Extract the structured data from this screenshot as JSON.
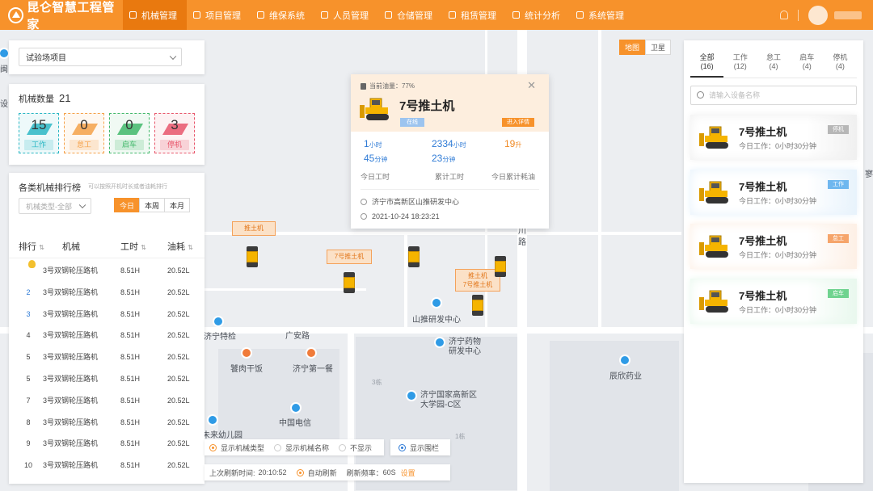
{
  "app": {
    "title": "昆仑智慧工程管家"
  },
  "nav": [
    {
      "label": "机械管理",
      "active": true,
      "icon": "machine-icon"
    },
    {
      "label": "项目管理",
      "active": false,
      "icon": "project-icon"
    },
    {
      "label": "维保系统",
      "active": false,
      "icon": "maintenance-icon"
    },
    {
      "label": "人员管理",
      "active": false,
      "icon": "people-icon"
    },
    {
      "label": "仓储管理",
      "active": false,
      "icon": "warehouse-icon"
    },
    {
      "label": "租赁管理",
      "active": false,
      "icon": "lease-icon"
    },
    {
      "label": "统计分析",
      "active": false,
      "icon": "stats-icon"
    },
    {
      "label": "系统管理",
      "active": false,
      "icon": "settings-icon"
    }
  ],
  "map_switch": {
    "map": "地图",
    "satellite": "卫星",
    "active": "map"
  },
  "project": {
    "selected": "试验场项目"
  },
  "machine_count": {
    "label": "机械数量",
    "total": "21",
    "stats": [
      {
        "num": "15",
        "label": "工作",
        "color": "#2bb7c4"
      },
      {
        "num": "0",
        "label": "怠工",
        "color": "#f5a24a"
      },
      {
        "num": "0",
        "label": "启车",
        "color": "#41b86a"
      },
      {
        "num": "3",
        "label": "停机",
        "color": "#e8566b"
      }
    ]
  },
  "ranking": {
    "title": "各类机械排行榜",
    "subtitle": "可以按照开机时长或者油耗排行",
    "type_select_placeholder": "机械类型-全部",
    "periods": [
      "今日",
      "本周",
      "本月"
    ],
    "active_period": "今日",
    "headers": {
      "rank": "排行",
      "name": "机械",
      "hours": "工时",
      "oil": "油耗"
    },
    "sort_icon": "sort-arrows-icon",
    "rows": [
      {
        "rank": "1",
        "name": "3号双钢轮压路机",
        "hours": "8.51H",
        "oil": "20.52L"
      },
      {
        "rank": "2",
        "name": "3号双钢轮压路机",
        "hours": "8.51H",
        "oil": "20.52L"
      },
      {
        "rank": "3",
        "name": "3号双钢轮压路机",
        "hours": "8.51H",
        "oil": "20.52L"
      },
      {
        "rank": "4",
        "name": "3号双钢轮压路机",
        "hours": "8.51H",
        "oil": "20.52L"
      },
      {
        "rank": "5",
        "name": "3号双钢轮压路机",
        "hours": "8.51H",
        "oil": "20.52L"
      },
      {
        "rank": "5",
        "name": "3号双钢轮压路机",
        "hours": "8.51H",
        "oil": "20.52L"
      },
      {
        "rank": "7",
        "name": "3号双钢轮压路机",
        "hours": "8.51H",
        "oil": "20.52L"
      },
      {
        "rank": "8",
        "name": "3号双钢轮压路机",
        "hours": "8.51H",
        "oil": "20.52L"
      },
      {
        "rank": "9",
        "name": "3号双钢轮压路机",
        "hours": "8.51H",
        "oil": "20.52L"
      },
      {
        "rank": "10",
        "name": "3号双钢轮压路机",
        "hours": "8.51H",
        "oil": "20.52L"
      }
    ]
  },
  "popup": {
    "oil_label": "当前油量：77%",
    "name": "7号推土机",
    "status": "在线",
    "detail_button": "进入详情",
    "stats": [
      {
        "line1": "1",
        "unit1": "小时",
        "line2": "45",
        "unit2": "分钟",
        "caption": "今日工时"
      },
      {
        "line1": "2334",
        "unit1": "小时",
        "line2": "23",
        "unit2": "分钟",
        "caption": "累计工时"
      },
      {
        "line1": "19",
        "unit1": "升",
        "line2": "",
        "unit2": "",
        "caption": "今日累计耗油"
      }
    ],
    "location": "济宁市高新区山推研发中心",
    "time": "2021-10-24  18:23:21"
  },
  "map_tags": {
    "tag_a": "推土机",
    "tag_b": "7号推土机",
    "tag_c_line1": "推土机",
    "tag_c_line2": "7号推土机"
  },
  "map_labels": {
    "l1": "济宁特检",
    "l2": "广安路",
    "l3": "饕肉干饭",
    "l4": "济宁第一餐",
    "l5": "山推研发中心",
    "l6": "济宁药物",
    "l6b": "研发中心",
    "l7": "济宁国家高新区",
    "l7b": "大学园-C区",
    "l8": "中国电信",
    "l9": "辰欣药业",
    "l10": "川",
    "l11": "路",
    "l12": "3栋",
    "l13": "1栋",
    "l14": "未来幼儿园",
    "l15": "闽",
    "l16": "设",
    "l17": "寥"
  },
  "right": {
    "tabs": [
      {
        "label": "全部",
        "count": "(16)",
        "active": true
      },
      {
        "label": "工作",
        "count": "(12)",
        "active": false
      },
      {
        "label": "怠工",
        "count": "(4)",
        "active": false
      },
      {
        "label": "启车",
        "count": "(4)",
        "active": false
      },
      {
        "label": "停机",
        "count": "(4)",
        "active": false
      }
    ],
    "search_placeholder": "请输入设备名称",
    "cards": [
      {
        "name": "7号推土机",
        "sub": "今日工作：0小时30分钟",
        "badge": "停机",
        "badge_color": "#b7b7b7",
        "tint": "#f0f0f0"
      },
      {
        "name": "7号推土机",
        "sub": "今日工作：0小时30分钟",
        "badge": "工作",
        "badge_color": "#6fb7ef",
        "tint": "#e8f3fc"
      },
      {
        "name": "7号推土机",
        "sub": "今日工作：0小时30分钟",
        "badge": "怠工",
        "badge_color": "#f6a56b",
        "tint": "#fdf0e6"
      },
      {
        "name": "7号推土机",
        "sub": "今日工作：0小时30分钟",
        "badge": "启车",
        "badge_color": "#6fd38f",
        "tint": "#e9f8ee"
      }
    ]
  },
  "bottom": {
    "opt1": "显示机械类型",
    "opt2": "显示机械名称",
    "opt3": "不显示",
    "opt4": "显示围栏",
    "refresh_label": "上次刷新时间:",
    "refresh_time": "20:10:52",
    "auto_refresh": "自动刷新",
    "freq_label": "刷新频率：",
    "freq_value": "60S",
    "settings_link": "设置"
  }
}
